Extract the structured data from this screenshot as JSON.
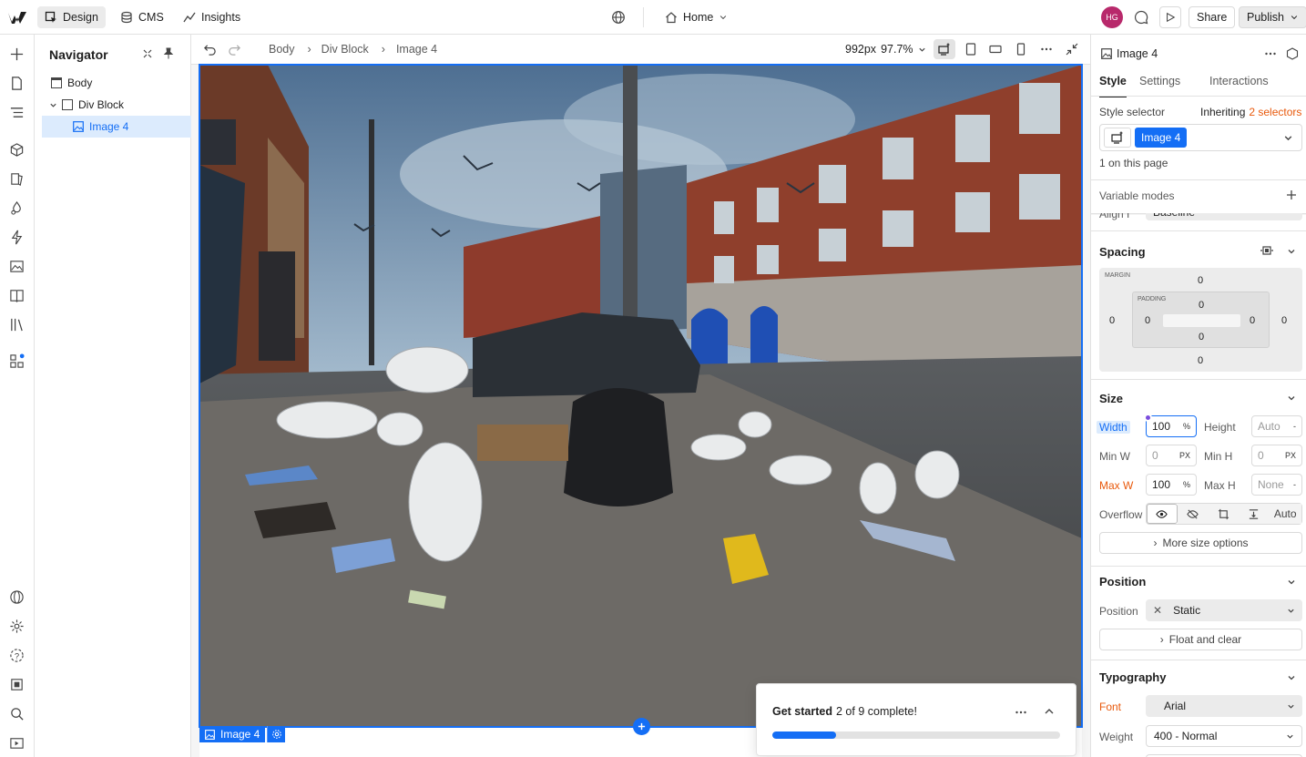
{
  "topbar": {
    "design_label": "Design",
    "cms_label": "CMS",
    "insights_label": "Insights",
    "page_label": "Home",
    "avatar_initials": "HG",
    "share_label": "Share",
    "publish_label": "Publish"
  },
  "navigator": {
    "title": "Navigator",
    "items": [
      {
        "label": "Body"
      },
      {
        "label": "Div Block"
      },
      {
        "label": "Image 4"
      }
    ]
  },
  "canvas": {
    "breadcrumb": [
      "Body",
      "Div Block",
      "Image 4"
    ],
    "width_readout": "992px",
    "zoom_readout": "97.7%",
    "selected_tag": "Image 4",
    "get_started": {
      "title": "Get started",
      "progress_text": "2 of 9 complete!",
      "progress_fraction": 0.222
    }
  },
  "right_panel": {
    "element_name": "Image 4",
    "tabs": [
      "Style",
      "Settings",
      "Interactions"
    ],
    "style_selector_label": "Style selector",
    "inheriting_label": "Inheriting",
    "inheriting_count": "2 selectors",
    "selector_chip": "Image 4",
    "on_page": "1 on this page",
    "variable_modes": "Variable modes",
    "align_label": "Align I",
    "align_value": "Baseline",
    "spacing": {
      "title": "Spacing",
      "margin_label": "MARGIN",
      "padding_label": "PADDING",
      "margin_top": "0",
      "margin_right": "0",
      "margin_bottom": "0",
      "margin_left": "0",
      "padding_top": "0",
      "padding_right": "0",
      "padding_bottom": "0",
      "padding_left": "0"
    },
    "size": {
      "title": "Size",
      "width_label": "Width",
      "width_value": "100",
      "width_unit": "%",
      "height_label": "Height",
      "height_value": "Auto",
      "height_unit": "-",
      "minw_label": "Min W",
      "minw_value": "0",
      "minw_unit": "PX",
      "minh_label": "Min H",
      "minh_value": "0",
      "minh_unit": "PX",
      "maxw_label": "Max W",
      "maxw_value": "100",
      "maxw_unit": "%",
      "maxh_label": "Max H",
      "maxh_value": "None",
      "maxh_unit": "-",
      "overflow_label": "Overflow",
      "overflow_auto": "Auto",
      "more_size": "More size options"
    },
    "position": {
      "title": "Position",
      "label": "Position",
      "value": "Static",
      "float_clear": "Float and clear"
    },
    "typography": {
      "title": "Typography",
      "font_label": "Font",
      "font_value": "Arial",
      "weight_label": "Weight",
      "weight_value": "400 - Normal"
    }
  },
  "colors": {
    "accent": "#146ef5",
    "override_orange": "#e8590c",
    "avatar": "#b8296b"
  }
}
